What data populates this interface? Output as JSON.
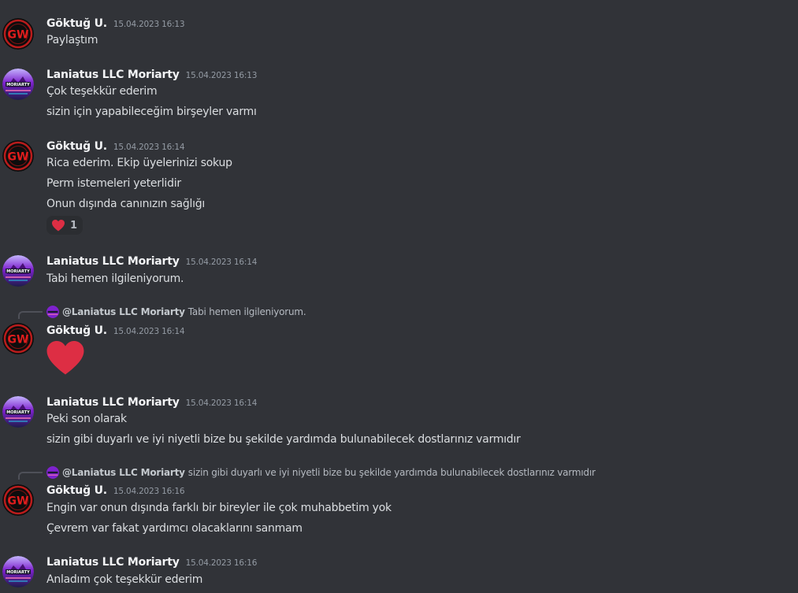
{
  "users": {
    "goktug": "Göktuğ U.",
    "moriarty": "Laniatus LLC Moriarty"
  },
  "avatars": {
    "goktug_logo_text": "GW",
    "moriarty_logo_text": "MORIARTY"
  },
  "colors": {
    "background": "#313338",
    "goktug_avatar_ring": "#b91c1c",
    "moriarty_avatar_accent": "#a855f7",
    "heart": "#dd2e44"
  },
  "messages": [
    {
      "author": "Göktuğ U.",
      "timestamp": "15.04.2023 16:13",
      "lines": [
        "Paylaştım"
      ]
    },
    {
      "author": "Laniatus LLC Moriarty",
      "timestamp": "15.04.2023 16:13",
      "lines": [
        "Çok teşekkür ederim",
        "sizin için yapabileceğim birşeyler varmı"
      ]
    },
    {
      "author": "Göktuğ U.",
      "timestamp": "15.04.2023 16:14",
      "lines": [
        "Rica ederim. Ekip üyelerinizi sokup",
        "Perm istemeleri yeterlidir",
        "Onun dışında canınızın sağlığı"
      ],
      "reaction": {
        "emoji": "heart",
        "count": "1"
      }
    },
    {
      "author": "Laniatus LLC Moriarty",
      "timestamp": "15.04.2023 16:14",
      "lines": [
        "Tabi hemen ilgileniyorum."
      ]
    },
    {
      "reply": {
        "mention": "@Laniatus LLC Moriarty",
        "text": "Tabi hemen ilgileniyorum."
      },
      "author": "Göktuğ U.",
      "timestamp": "15.04.2023 16:14",
      "big_emoji": "heart"
    },
    {
      "author": "Laniatus LLC Moriarty",
      "timestamp": "15.04.2023 16:14",
      "lines": [
        "Peki son olarak",
        "sizin gibi duyarlı ve iyi niyetli bize bu şekilde yardımda bulunabilecek dostlarınız varmıdır"
      ]
    },
    {
      "reply": {
        "mention": "@Laniatus LLC Moriarty",
        "text": "sizin gibi duyarlı ve iyi niyetli bize bu şekilde yardımda bulunabilecek dostlarınız varmıdır"
      },
      "author": "Göktuğ U.",
      "timestamp": "15.04.2023 16:16",
      "lines": [
        "Engin var onun dışında farklı bir bireyler ile çok muhabbetim yok",
        "Çevrem var fakat yardımcı olacaklarını sanmam"
      ]
    },
    {
      "author": "Laniatus LLC Moriarty",
      "timestamp": "15.04.2023 16:16",
      "lines": [
        "Anladım çok teşekkür ederim"
      ]
    }
  ]
}
